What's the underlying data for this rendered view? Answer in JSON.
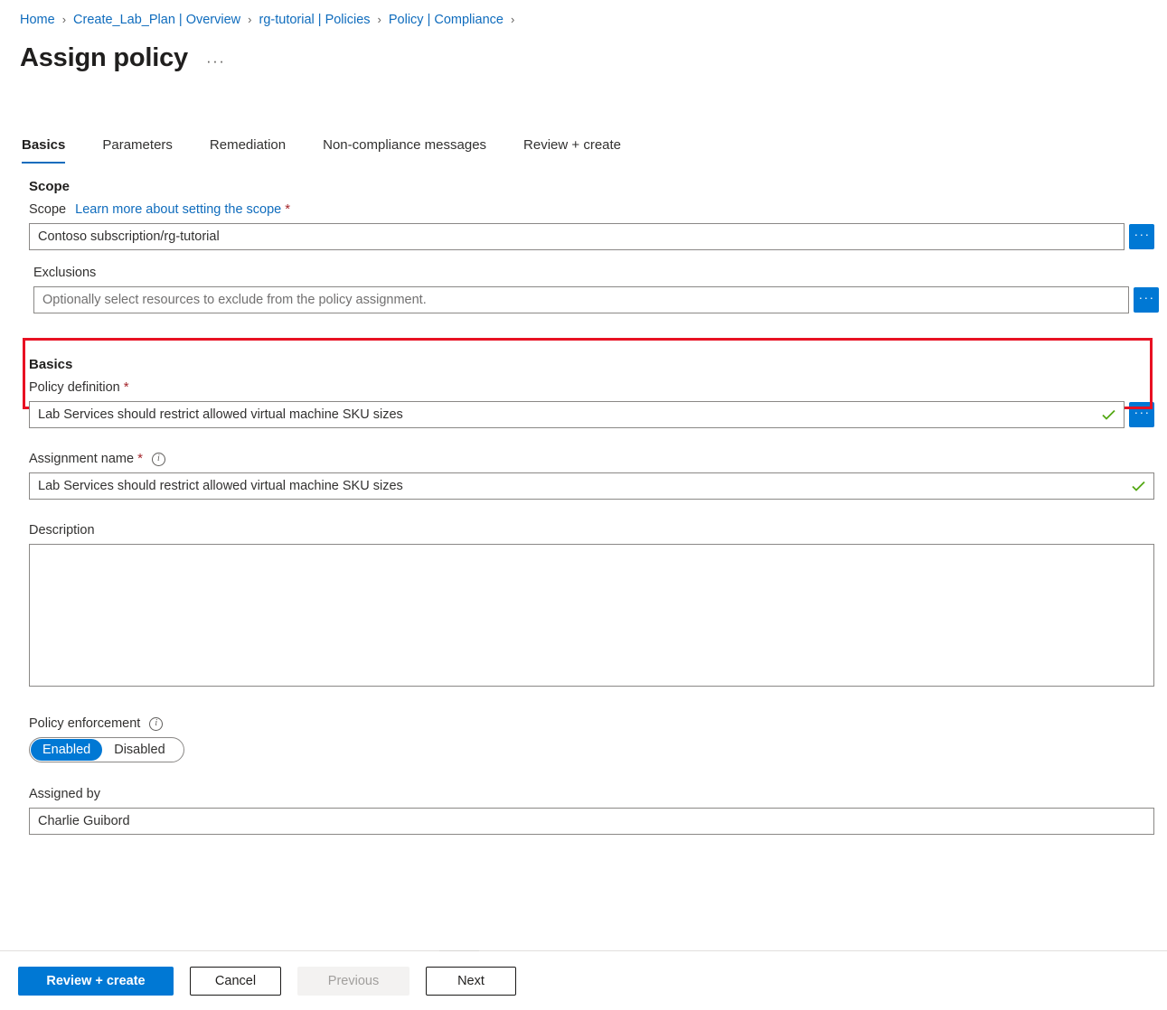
{
  "breadcrumb": {
    "separator": "›",
    "items": [
      {
        "label": "Home"
      },
      {
        "label": "Create_Lab_Plan | Overview"
      },
      {
        "label": "rg-tutorial | Policies"
      },
      {
        "label": "Policy | Compliance"
      }
    ]
  },
  "header": {
    "title": "Assign policy",
    "more_actions": "···"
  },
  "tabs": [
    {
      "label": "Basics",
      "active": true
    },
    {
      "label": "Parameters",
      "active": false
    },
    {
      "label": "Remediation",
      "active": false
    },
    {
      "label": "Non-compliance messages",
      "active": false
    },
    {
      "label": "Review + create",
      "active": false
    }
  ],
  "scope_section": {
    "heading": "Scope",
    "scope_label": "Scope",
    "scope_link": "Learn more about setting the scope",
    "required_mark": "*",
    "scope_value": "Contoso subscription/rg-tutorial",
    "scope_browse_button": "···",
    "exclusions_label": "Exclusions",
    "exclusions_value": "",
    "exclusions_placeholder": "Optionally select resources to exclude from the policy assignment.",
    "exclusions_browse_button": "···"
  },
  "basics_section": {
    "heading": "Basics",
    "policy_definition_label": "Policy definition",
    "policy_definition_required": "*",
    "policy_definition_value": "Lab Services should restrict allowed virtual machine SKU sizes",
    "policy_definition_browse_button": "···",
    "assignment_name_label": "Assignment name",
    "assignment_name_required": "*",
    "assignment_name_info": "i",
    "assignment_name_value": "Lab Services should restrict allowed virtual machine SKU sizes",
    "description_label": "Description",
    "description_value": "",
    "policy_enforcement_label": "Policy enforcement",
    "policy_enforcement_info": "i",
    "policy_enforcement_options": [
      {
        "label": "Enabled",
        "selected": true
      },
      {
        "label": "Disabled",
        "selected": false
      }
    ],
    "enabled_label": "Enabled",
    "disabled_label": "Disabled",
    "assigned_by_label": "Assigned by",
    "assigned_by_value": "Charlie Guibord"
  },
  "footer": {
    "review_create": "Review + create",
    "cancel": "Cancel",
    "previous": "Previous",
    "next": "Next"
  },
  "colors": {
    "accent_blue": "#0078d4",
    "link_blue": "#0f6cbd",
    "highlight_red": "#e81123",
    "required_red": "#a4262c",
    "valid_green": "#54a814"
  }
}
